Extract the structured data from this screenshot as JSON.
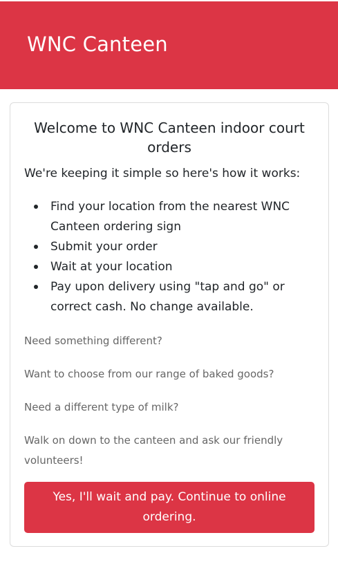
{
  "header": {
    "title": "WNC Canteen"
  },
  "card": {
    "title": "Welcome to WNC Canteen indoor court orders",
    "intro": "We're keeping it simple so here's how it works:",
    "steps": [
      "Find your location from the nearest WNC Canteen ordering sign",
      "Submit your order",
      "Wait at your location",
      "Pay upon delivery using \"tap and go\" or correct cash. No change available."
    ],
    "notes": [
      "Need something different?",
      "Want to choose from our range of baked goods?",
      "Need a different type of milk?",
      "Walk on down to the canteen and ask our friendly volunteers!"
    ],
    "cta_label": "Yes, I'll wait and pay. Continue to online ordering."
  },
  "colors": {
    "brand": "#dc3545",
    "text": "#212529",
    "muted": "#666666",
    "border": "#dcdcdc"
  }
}
